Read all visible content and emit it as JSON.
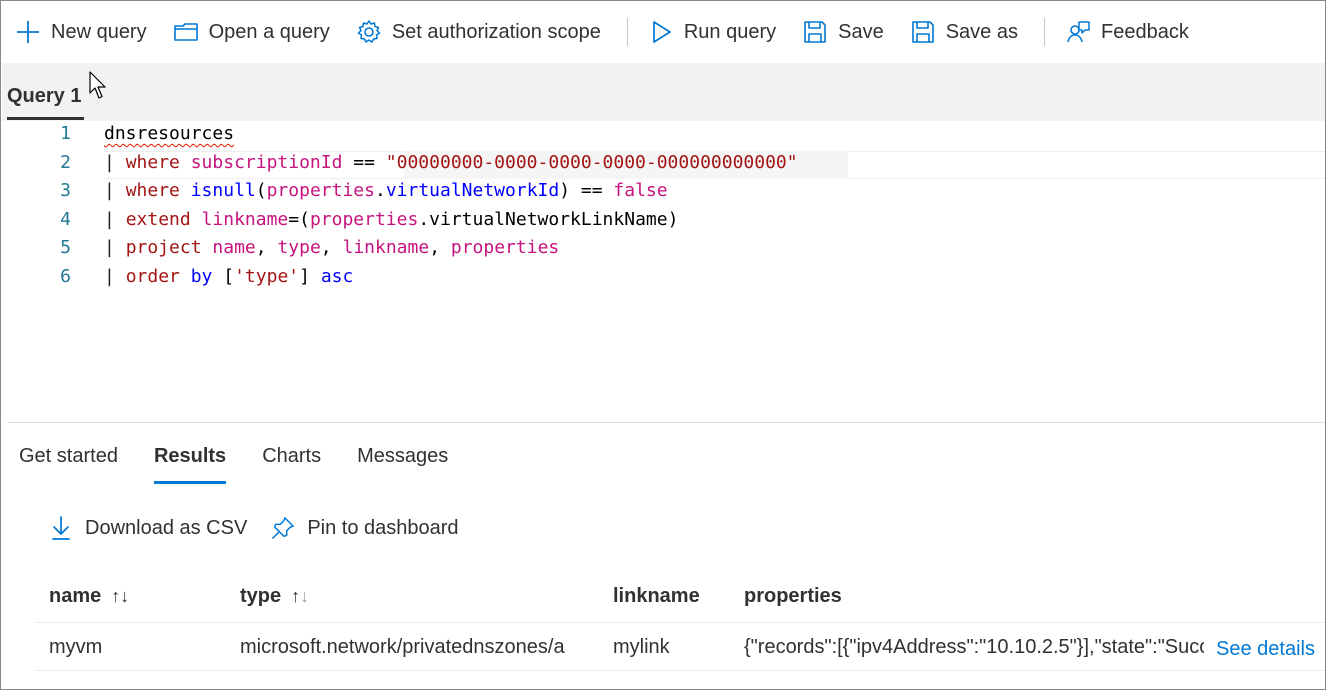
{
  "toolbar": {
    "new_query": "New query",
    "open_query": "Open a query",
    "set_scope": "Set authorization scope",
    "run_query": "Run query",
    "save": "Save",
    "save_as": "Save as",
    "feedback": "Feedback"
  },
  "query_tab": {
    "label": "Query 1"
  },
  "editor": {
    "line_numbers": [
      "1",
      "2",
      "3",
      "4",
      "5",
      "6"
    ],
    "lines": [
      [
        {
          "t": "dnsresources",
          "c": "plain squiggle"
        }
      ],
      [
        {
          "t": "| ",
          "c": "pipe"
        },
        {
          "t": "where",
          "c": "kw"
        },
        {
          "t": " ",
          "c": "plain"
        },
        {
          "t": "subscriptionId",
          "c": "prop"
        },
        {
          "t": " == ",
          "c": "plain"
        },
        {
          "t": "\"00000000-0000-0000-0000-000000000000\"",
          "c": "str"
        }
      ],
      [
        {
          "t": "| ",
          "c": "pipe"
        },
        {
          "t": "where",
          "c": "kw"
        },
        {
          "t": " ",
          "c": "plain"
        },
        {
          "t": "isnull",
          "c": "fn"
        },
        {
          "t": "(",
          "c": "plain"
        },
        {
          "t": "properties",
          "c": "prop"
        },
        {
          "t": ".",
          "c": "plain"
        },
        {
          "t": "virtualNetworkId",
          "c": "fn"
        },
        {
          "t": ") == ",
          "c": "plain"
        },
        {
          "t": "false",
          "c": "prop"
        }
      ],
      [
        {
          "t": "| ",
          "c": "pipe"
        },
        {
          "t": "extend",
          "c": "kw"
        },
        {
          "t": " ",
          "c": "plain"
        },
        {
          "t": "linkname",
          "c": "prop"
        },
        {
          "t": "=(",
          "c": "plain"
        },
        {
          "t": "properties",
          "c": "prop"
        },
        {
          "t": ".virtualNetworkLinkName)",
          "c": "plain"
        }
      ],
      [
        {
          "t": "| ",
          "c": "pipe"
        },
        {
          "t": "project",
          "c": "kw"
        },
        {
          "t": " ",
          "c": "plain"
        },
        {
          "t": "name",
          "c": "prop"
        },
        {
          "t": ", ",
          "c": "plain"
        },
        {
          "t": "type",
          "c": "prop"
        },
        {
          "t": ", ",
          "c": "plain"
        },
        {
          "t": "linkname",
          "c": "prop"
        },
        {
          "t": ", ",
          "c": "plain"
        },
        {
          "t": "properties",
          "c": "prop"
        }
      ],
      [
        {
          "t": "| ",
          "c": "pipe"
        },
        {
          "t": "order",
          "c": "kw"
        },
        {
          "t": " ",
          "c": "plain"
        },
        {
          "t": "by",
          "c": "fn"
        },
        {
          "t": " [",
          "c": "plain"
        },
        {
          "t": "'type'",
          "c": "str"
        },
        {
          "t": "] ",
          "c": "plain"
        },
        {
          "t": "asc",
          "c": "fn"
        }
      ]
    ]
  },
  "results_tabs": {
    "get_started": "Get started",
    "results": "Results",
    "charts": "Charts",
    "messages": "Messages",
    "active": "results"
  },
  "actions": {
    "download_csv": "Download as CSV",
    "pin_dashboard": "Pin to dashboard"
  },
  "table": {
    "columns": {
      "name": "name",
      "type": "type",
      "linkname": "linkname",
      "properties": "properties"
    },
    "rows": [
      {
        "name": "myvm",
        "type": "microsoft.network/privatednszones/a",
        "linkname": "mylink",
        "properties": "{\"records\":[{\"ipv4Address\":\"10.10.2.5\"}],\"state\":\"Succ...",
        "details": "See details"
      }
    ]
  },
  "colors": {
    "accent": "#0078d4",
    "keyword": "#a31515",
    "function": "#0000ff",
    "property": "#c5147d",
    "line_number": "#237893"
  },
  "icons": [
    "plus-icon",
    "folder-icon",
    "gear-icon",
    "play-icon",
    "save-icon",
    "save-as-icon",
    "feedback-icon",
    "download-icon",
    "pin-icon",
    "sort-icon"
  ]
}
